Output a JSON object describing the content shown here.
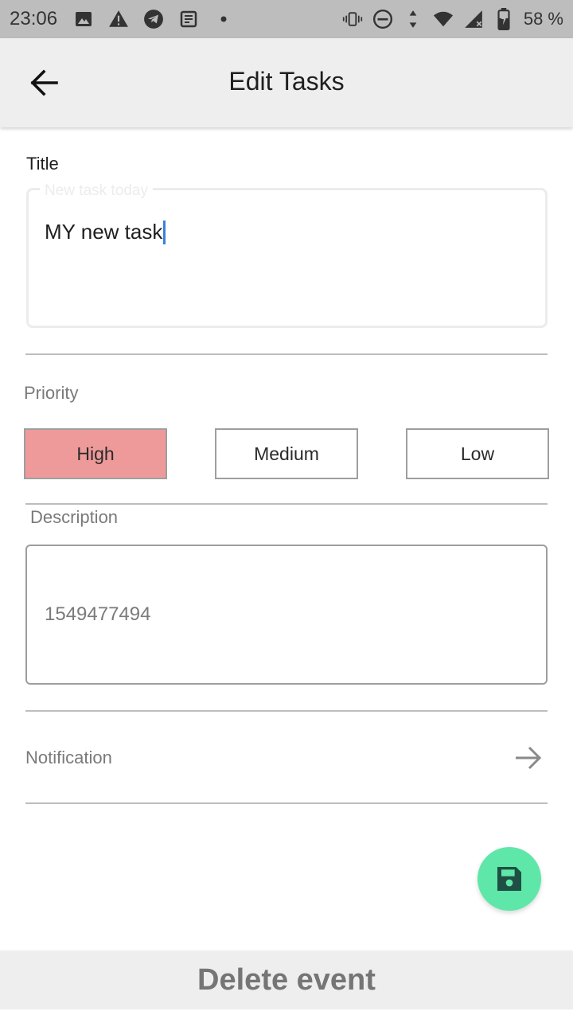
{
  "status_bar": {
    "time": "23:06",
    "battery_text": "58 %",
    "left_icons": [
      "image-icon",
      "warning-icon",
      "telegram-icon",
      "news-icon",
      "dot-icon"
    ],
    "right_icons": [
      "vibrate-icon",
      "do-not-disturb-icon",
      "data-arrows-icon",
      "wifi-icon",
      "signal-icon",
      "battery-icon"
    ]
  },
  "app_bar": {
    "title": "Edit Tasks",
    "back_icon": "arrow-left-icon"
  },
  "form": {
    "title_label": "Title",
    "title_placeholder": "New task today",
    "title_value": "MY new task",
    "priority_label": "Priority",
    "priority_options": [
      "High",
      "Medium",
      "Low"
    ],
    "priority_selected": "High",
    "description_label": "Description",
    "description_value": "1549477494",
    "notification_label": "Notification",
    "notification_icon": "arrow-right-icon"
  },
  "fab": {
    "icon": "save-icon"
  },
  "delete_button": {
    "label": "Delete event"
  },
  "colors": {
    "high_priority": "#ef9a9a",
    "fab": "#5ee7a8",
    "fab_icon": "#1f4f44",
    "caret": "#3d7fdb",
    "status_bar": "#bdbdbd",
    "app_bar": "#eeeeee"
  }
}
